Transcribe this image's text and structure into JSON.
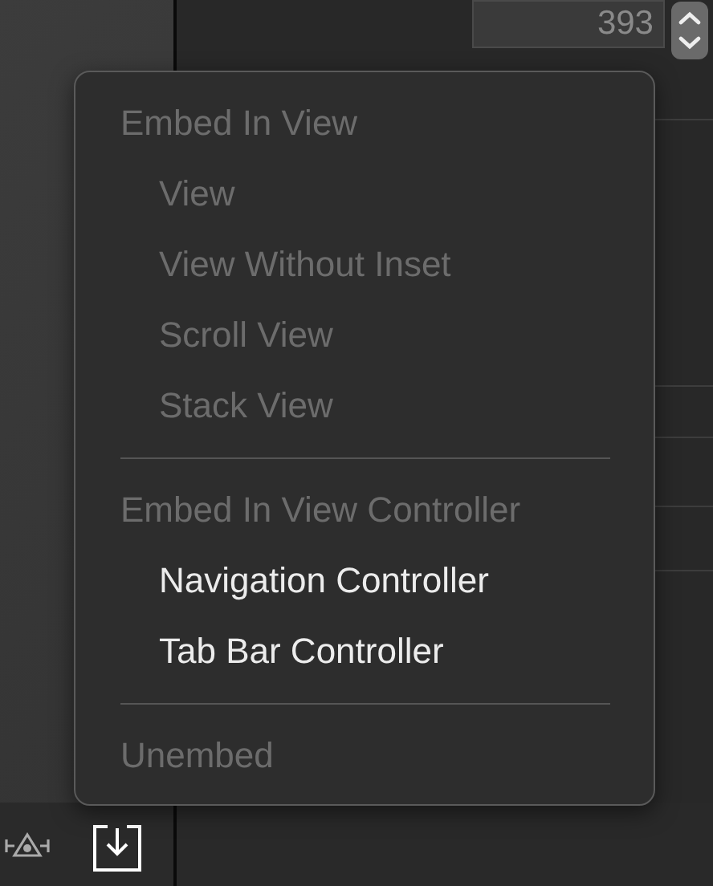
{
  "inspector": {
    "width_field": {
      "value": "393"
    }
  },
  "menu": {
    "entries": [
      {
        "kind": "group",
        "label": "Embed In View",
        "disabled": true,
        "children": [
          {
            "label": "View",
            "disabled": true
          },
          {
            "label": "View Without Inset",
            "disabled": true
          },
          {
            "label": "Scroll View",
            "disabled": true
          },
          {
            "label": "Stack View",
            "disabled": true
          }
        ]
      },
      {
        "kind": "separator"
      },
      {
        "kind": "group",
        "label": "Embed In View Controller",
        "disabled": true,
        "children": [
          {
            "label": "Navigation Controller",
            "disabled": false
          },
          {
            "label": "Tab Bar Controller",
            "disabled": false
          }
        ]
      },
      {
        "kind": "separator"
      },
      {
        "kind": "item",
        "label": "Unembed",
        "disabled": true
      }
    ]
  }
}
